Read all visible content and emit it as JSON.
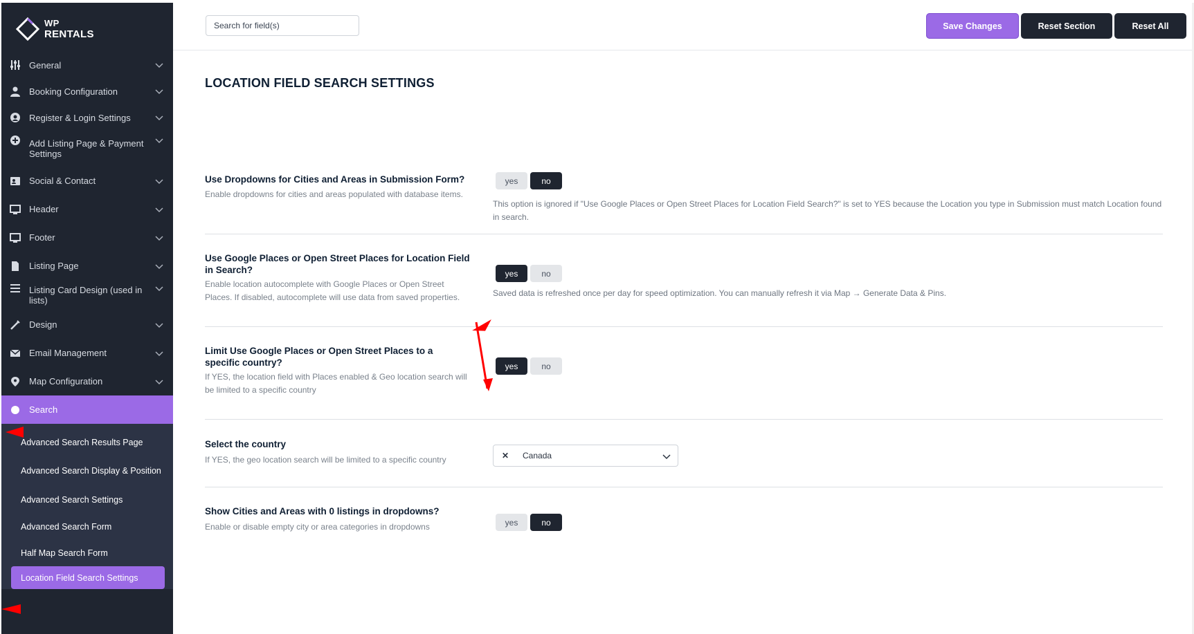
{
  "brand": {
    "line1": "WP",
    "line2": "RENTALS"
  },
  "colors": {
    "sidebar": "#1f2530",
    "accent": "#9b6ae6",
    "annotation": "#ff0000"
  },
  "sidebar": {
    "items": [
      {
        "label": "General",
        "icon": "sliders-icon"
      },
      {
        "label": "Booking Configuration",
        "icon": "user-icon"
      },
      {
        "label": "Register & Login Settings",
        "icon": "login-icon"
      },
      {
        "label": "Add Listing Page & Payment Settings",
        "icon": "plus-circle-icon"
      },
      {
        "label": "Social & Contact",
        "icon": "contact-card-icon"
      },
      {
        "label": "Header",
        "icon": "monitor-icon"
      },
      {
        "label": "Footer",
        "icon": "monitor-icon"
      },
      {
        "label": "Listing Page",
        "icon": "page-icon"
      },
      {
        "label": "Listing Card Design (used in lists)",
        "icon": "list-icon"
      },
      {
        "label": "Design",
        "icon": "brush-icon"
      },
      {
        "label": "Email Management",
        "icon": "envelope-icon"
      },
      {
        "label": "Map Configuration",
        "icon": "map-pin-icon"
      },
      {
        "label": "Search",
        "icon": "search-icon"
      }
    ],
    "sub_items": [
      "Advanced Search Results Page",
      "Advanced Search Display & Position",
      "Advanced Search Settings",
      "Advanced Search Form",
      "Half Map Search Form",
      "Location Field Search Settings"
    ]
  },
  "topbar": {
    "search_placeholder": "Search for field(s)",
    "save_label": "Save Changes",
    "reset_section_label": "Reset Section",
    "reset_all_label": "Reset All"
  },
  "main": {
    "title": "LOCATION FIELD SEARCH SETTINGS",
    "options": [
      {
        "title": "Use Dropdowns for Cities and Areas in Submission Form?",
        "description": "Enable dropdowns for cities and areas populated with database items.",
        "yes_label": "yes",
        "no_label": "no",
        "selected": "no",
        "note": "This option is ignored if \"Use Google Places or Open Street Places for Location Field Search?\" is set to YES because the Location you type in Submission must match Location found in search."
      },
      {
        "title": "Use Google Places or Open Street Places for Location Field in Search?",
        "description": "Enable location autocomplete with Google Places or Open Street Places. If disabled, autocomplete will use data from saved properties.",
        "yes_label": "yes",
        "no_label": "no",
        "selected": "yes",
        "note": "Saved data is refreshed once per day for speed optimization. You can manually refresh it via Map → Generate Data & Pins."
      },
      {
        "title": "Limit Use Google Places or Open Street Places to a specific country?",
        "description": "If YES, the location field with Places enabled & Geo location search will be limited to a specific country",
        "yes_label": "yes",
        "no_label": "no",
        "selected": "yes"
      },
      {
        "title": "Select the country",
        "description": "If YES, the geo location search will be limited to a specific country",
        "select_value": "Canada"
      },
      {
        "title": "Show Cities and Areas with 0 listings in dropdowns?",
        "description": "Enable or disable empty city or area categories in dropdowns",
        "yes_label": "yes",
        "no_label": "no",
        "selected": "no"
      }
    ]
  }
}
